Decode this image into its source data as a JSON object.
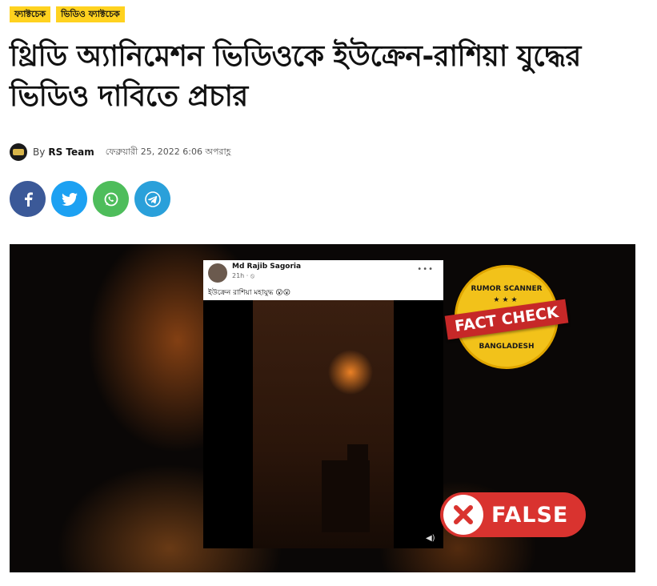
{
  "tags": [
    "ফ্যাক্টচেক",
    "ভিডিও ফ্যাক্টচেক"
  ],
  "title": "থ্রিডি অ্যানিমেশন ভিডিওকে ইউক্রেন-রাশিয়া যুদ্ধের ভিডিও দাবিতে প্রচার",
  "meta": {
    "by": "By",
    "author": "RS Team",
    "date": "ফেব্রুয়ারী 25, 2022 6:06 অপরাহ্ণ"
  },
  "share": {
    "icons": [
      "facebook-icon",
      "twitter-icon",
      "whatsapp-icon",
      "telegram-icon"
    ],
    "colors": {
      "facebook": "#3b5998",
      "twitter": "#1da1f2",
      "whatsapp": "#4ebd5b",
      "telegram": "#2aa0da"
    }
  },
  "media": {
    "post": {
      "name": "Md Rajib Sagoria",
      "time": "21h · ⦸",
      "text": "ইউক্রেন রাশিয়া মহাযুদ্ধ 😮😮",
      "dots": "•••"
    },
    "badge": {
      "top": "RUMOR SCANNER",
      "ribbon": "FACT CHECK",
      "bottom": "BANGLADESH",
      "stars": "★★★"
    },
    "verdict": "FALSE",
    "accent": "#d9332f"
  }
}
